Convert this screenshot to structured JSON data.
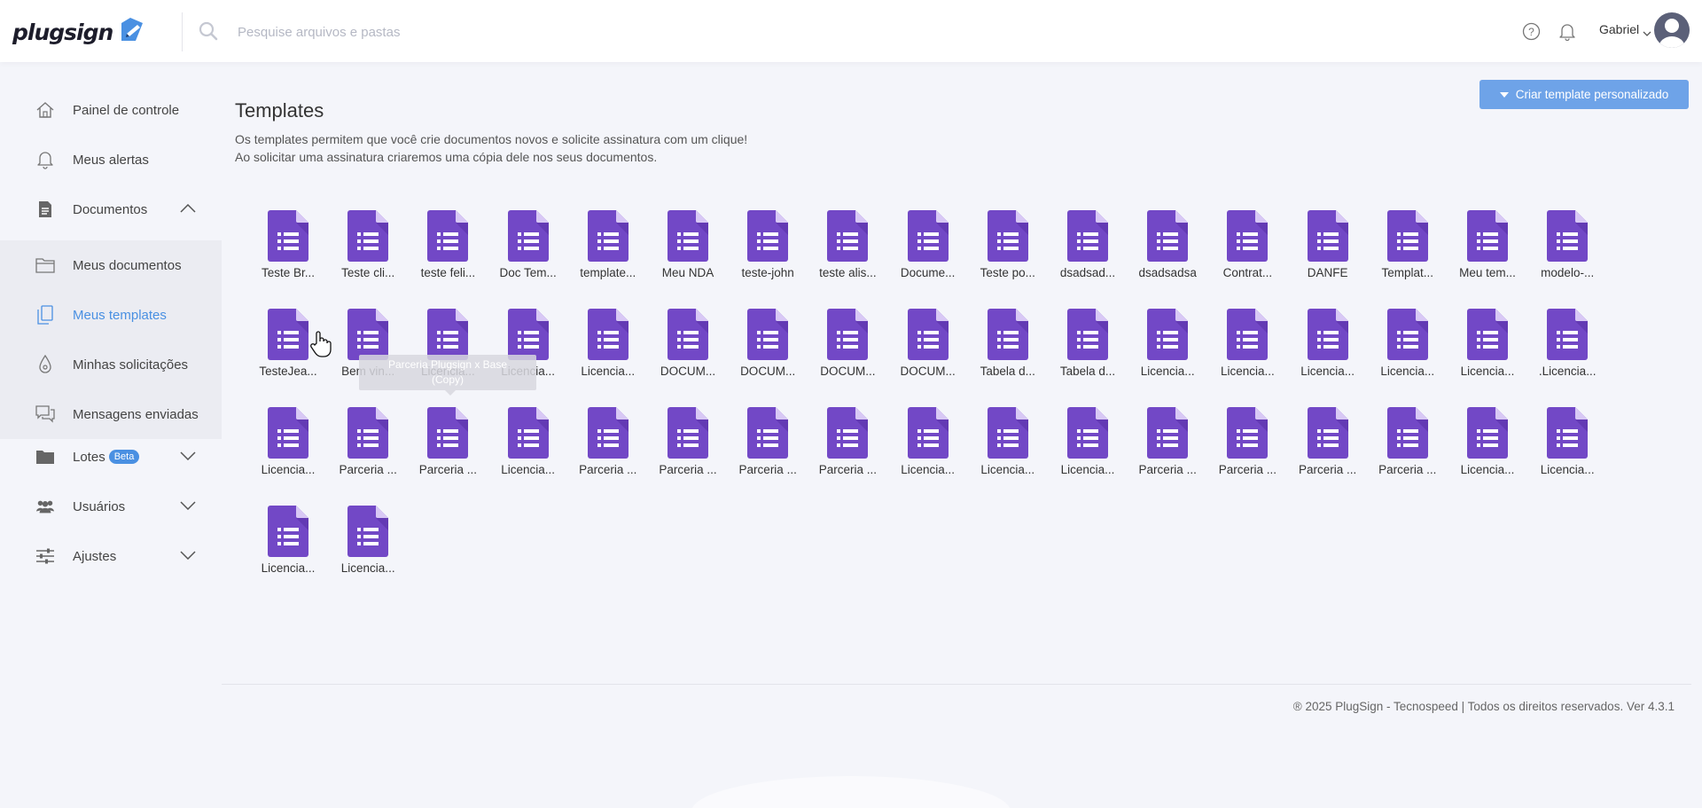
{
  "app": {
    "logo_text": "plugsign"
  },
  "search": {
    "placeholder": "Pesquise arquivos e pastas"
  },
  "user": {
    "name": "Gabriel"
  },
  "sidebar": {
    "items": [
      {
        "label": "Painel de controle",
        "icon": "home-icon"
      },
      {
        "label": "Meus alertas",
        "icon": "bell-icon"
      },
      {
        "label": "Documentos",
        "icon": "document-icon",
        "expanded": true
      },
      {
        "label": "Meus documentos",
        "icon": "folder-icon"
      },
      {
        "label": "Meus templates",
        "icon": "template-icon",
        "active": true
      },
      {
        "label": "Minhas solicitações",
        "icon": "pen-nib-icon"
      },
      {
        "label": "Mensagens enviadas",
        "icon": "messages-icon"
      },
      {
        "label": "Lotes",
        "icon": "folder-filled-icon",
        "badge": "Beta"
      },
      {
        "label": "Usuários",
        "icon": "users-icon"
      },
      {
        "label": "Ajustes",
        "icon": "sliders-icon"
      }
    ]
  },
  "main": {
    "title": "Templates",
    "description_line1": "Os templates permitem que você crie documentos novos e solicite assinatura com um clique!",
    "description_line2": "Ao solicitar uma assinatura criaremos uma cópia dele nos seus documentos.",
    "create_button": "Criar template personalizado",
    "tooltip_line1": "Parceria Plugsign x Base",
    "tooltip_line2": "(Copy)"
  },
  "templates": [
    "Teste Br...",
    "Teste cli...",
    "teste feli...",
    "Doc Tem...",
    "template...",
    "Meu NDA",
    "teste-john",
    "teste alis...",
    "Docume...",
    "Teste po...",
    "dsadsad...",
    "dsadsadsa",
    "Contrat...",
    "DANFE",
    "Templat...",
    "Meu tem...",
    "modelo-...",
    "TesteJea...",
    "Bem vin...",
    "Licencia...",
    "Licencia...",
    "Licencia...",
    "DOCUM...",
    "DOCUM...",
    "DOCUM...",
    "DOCUM...",
    "Tabela d...",
    "Tabela d...",
    "Licencia...",
    "Licencia...",
    "Licencia...",
    "Licencia...",
    "Licencia...",
    ".Licencia...",
    "Licencia...",
    "Parceria ...",
    "Parceria ...",
    "Licencia...",
    "Parceria ...",
    "Parceria ...",
    "Parceria ...",
    "Parceria ...",
    "Licencia...",
    "Licencia...",
    "Licencia...",
    "Parceria ...",
    "Parceria ...",
    "Parceria ...",
    "Parceria ...",
    "Licencia...",
    "Licencia...",
    "Licencia...",
    "Licencia..."
  ],
  "colors": {
    "accent": "#4a90e2",
    "doc_icon": "#7248c6",
    "doc_icon_dark": "#5a32a8",
    "button": "#6ea3e8"
  },
  "footer": {
    "text": "® 2025 PlugSign - Tecnospeed | Todos os direitos reservados. Ver 4.3.1"
  }
}
